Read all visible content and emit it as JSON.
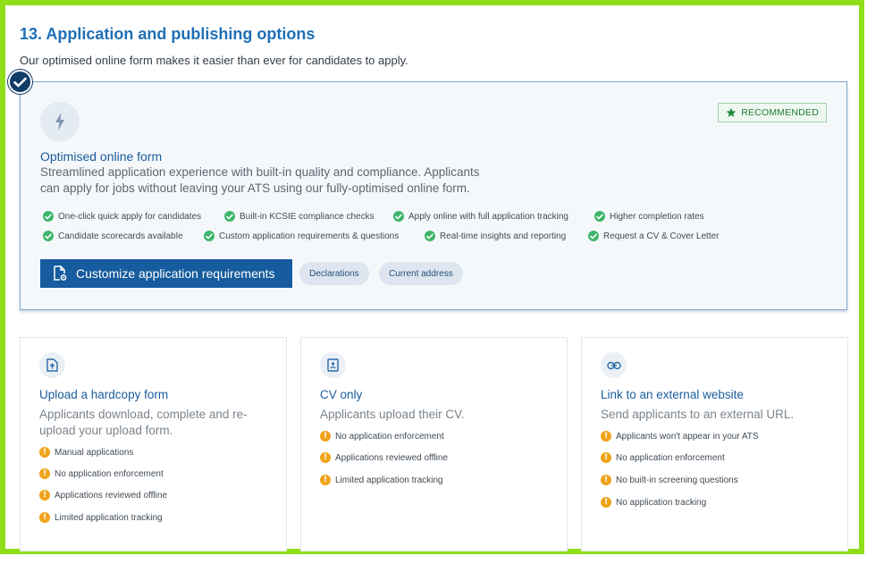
{
  "section": {
    "title": "13. Application and publishing options",
    "subtitle": "Our optimised online form makes it easier than ever for candidates to apply."
  },
  "primary": {
    "icon": "lightning-icon",
    "badge": "RECOMMENDED",
    "title": "Optimised online form",
    "description_line1": "Streamlined application experience with built-in quality and compliance. Applicants",
    "description_line2": "can apply for jobs without leaving your ATS using our fully-optimised online form.",
    "features": [
      "One-click quick apply for candidates",
      "Built-in KCSIE compliance checks",
      "Apply online with full application tracking",
      "Higher completion rates",
      "Candidate scorecards available",
      "Custom application requirements & questions",
      "Real-time insights and reporting",
      "Request a CV & Cover Letter"
    ],
    "cta_label": "Customize application requirements",
    "chips": [
      "Declarations",
      "Current address"
    ]
  },
  "options": [
    {
      "icon": "upload-file-icon",
      "title": "Upload a hardcopy form",
      "description_line1": "Applicants download, complete and re-",
      "description_line2": "upload your upload form.",
      "warnings": [
        "Manual applications",
        "No application enforcement",
        "Applications reviewed offline",
        "Limited application tracking"
      ]
    },
    {
      "icon": "cv-document-icon",
      "title": "CV only",
      "description_line1": "Applicants upload their CV.",
      "description_line2": "",
      "warnings": [
        "No application enforcement",
        "Applications reviewed offline",
        "Limited application tracking"
      ]
    },
    {
      "icon": "link-icon",
      "title": "Link to an external website",
      "description_line1": "Send applicants to an external URL.",
      "description_line2": "",
      "warnings": [
        "Applicants won't appear in your ATS",
        "No application enforcement",
        "No built-in screening questions",
        "No application tracking"
      ]
    }
  ],
  "colors": {
    "accent": "#1f6fb5",
    "primary_button": "#165c9e",
    "check_green": "#3fb66b",
    "warning_orange": "#f0a31a",
    "frame_green": "#8fde1a"
  }
}
